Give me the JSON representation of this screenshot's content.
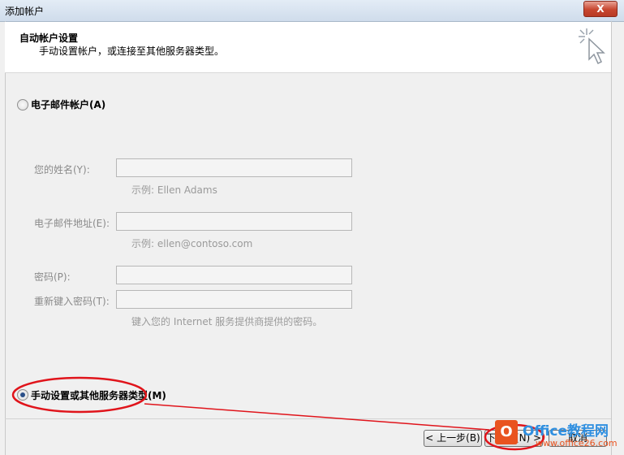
{
  "window": {
    "title": "添加帐户",
    "close_label": "X"
  },
  "header": {
    "title": "自动帐户设置",
    "subtitle": "手动设置帐户，或连接至其他服务器类型。"
  },
  "email_option": {
    "label": "电子邮件帐户(A)",
    "selected": false
  },
  "fields": {
    "name": {
      "label": "您的姓名(Y):",
      "value": "",
      "hint": "示例: Ellen Adams"
    },
    "email": {
      "label": "电子邮件地址(E):",
      "value": "",
      "hint": "示例: ellen@contoso.com"
    },
    "password": {
      "label": "密码(P):",
      "value": ""
    },
    "password_confirm": {
      "label": "重新键入密码(T):",
      "value": ""
    },
    "password_hint": "键入您的 Internet 服务提供商提供的密码。"
  },
  "manual_option": {
    "label": "手动设置或其他服务器类型(M)",
    "selected": true
  },
  "buttons": {
    "back": "< 上一步(B)",
    "next": "下一步(N) >",
    "cancel": "取消"
  },
  "watermark": {
    "logo": "O",
    "title": "Office教程网",
    "url": "www.office26.com"
  }
}
